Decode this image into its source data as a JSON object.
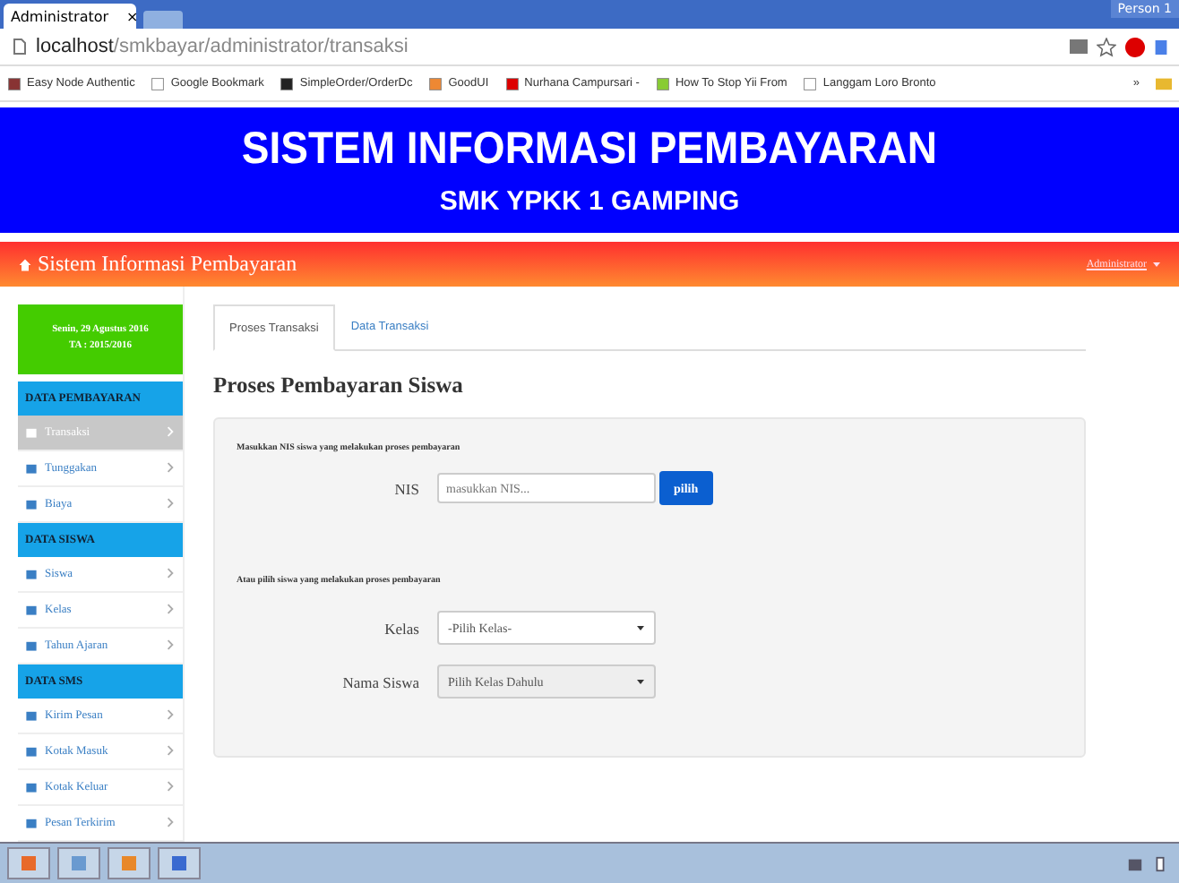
{
  "browser": {
    "tab_title": "Administrator",
    "close": "×",
    "profile": "Person 1",
    "url_host": "localhost",
    "url_path": "/smkbayar/administrator/transaksi",
    "bookmarks": [
      "Easy Node Authentic",
      "Google Bookmark",
      "SimpleOrder/OrderDc",
      "GoodUI",
      "Nurhana Campursari -",
      "How To Stop Yii From",
      "Langgam Loro Bronto"
    ],
    "more": "»"
  },
  "banner": {
    "title": "SISTEM INFORMASI PEMBAYARAN",
    "subtitle": "SMK YPKK 1 GAMPING"
  },
  "navbar": {
    "brand": "Sistem Informasi Pembayaran",
    "user": "Administrator"
  },
  "sidebar": {
    "date": "Senin, 29 Agustus 2016",
    "year": "TA : 2015/2016",
    "sections": [
      {
        "heading": "DATA PEMBAYARAN",
        "items": [
          {
            "label": "Transaksi",
            "selected": true
          },
          {
            "label": "Tunggakan",
            "selected": false
          },
          {
            "label": "Biaya",
            "selected": false
          }
        ]
      },
      {
        "heading": "DATA SISWA",
        "items": [
          {
            "label": "Siswa",
            "selected": false
          },
          {
            "label": "Kelas",
            "selected": false
          },
          {
            "label": "Tahun Ajaran",
            "selected": false
          }
        ]
      },
      {
        "heading": "DATA SMS",
        "items": [
          {
            "label": "Kirim Pesan",
            "selected": false
          },
          {
            "label": "Kotak Masuk",
            "selected": false
          },
          {
            "label": "Kotak Keluar",
            "selected": false
          },
          {
            "label": "Pesan Terkirim",
            "selected": false
          }
        ]
      }
    ]
  },
  "tabs": [
    {
      "label": "Proses Transaksi",
      "selected": true
    },
    {
      "label": "Data Transaksi",
      "selected": false
    }
  ],
  "heading": "Proses Pembayaran Siswa",
  "form": {
    "nis_hint": "Masukkan NIS siswa yang melakukan proses pembayaran",
    "nis_label": "NIS",
    "nis_placeholder": "masukkan NIS...",
    "button": "pilih",
    "alt_hint": "Atau pilih siswa yang melakukan proses pembayaran",
    "kelas_label": "Kelas",
    "kelas_value": "-Pilih Kelas-",
    "nama_label": "Nama Siswa",
    "nama_value": "Pilih Kelas Dahulu",
    "nama_disabled": true
  }
}
